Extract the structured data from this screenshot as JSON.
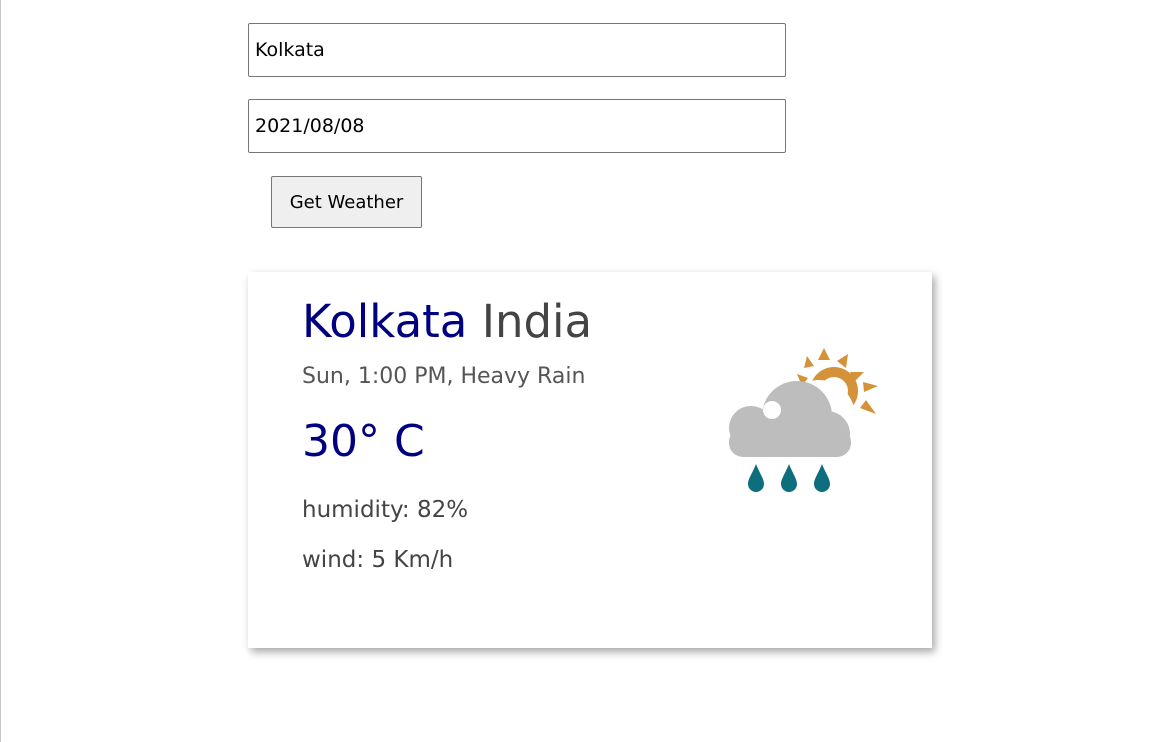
{
  "form": {
    "city_value": "Kolkata",
    "date_value": "2021/08/08",
    "submit_label": "Get Weather"
  },
  "card": {
    "city": "Kolkata",
    "country": "India",
    "summary": "Sun, 1:00 PM, Heavy Rain",
    "temperature": "30° C",
    "humidity": "humidity: 82%",
    "wind": "wind: 5 Km/h",
    "icon": "cloud-sun-rain-icon"
  },
  "colors": {
    "accent": "#000080",
    "sun": "#D4923A",
    "cloud": "#BDBDBD",
    "rain": "#0E6E7E"
  }
}
